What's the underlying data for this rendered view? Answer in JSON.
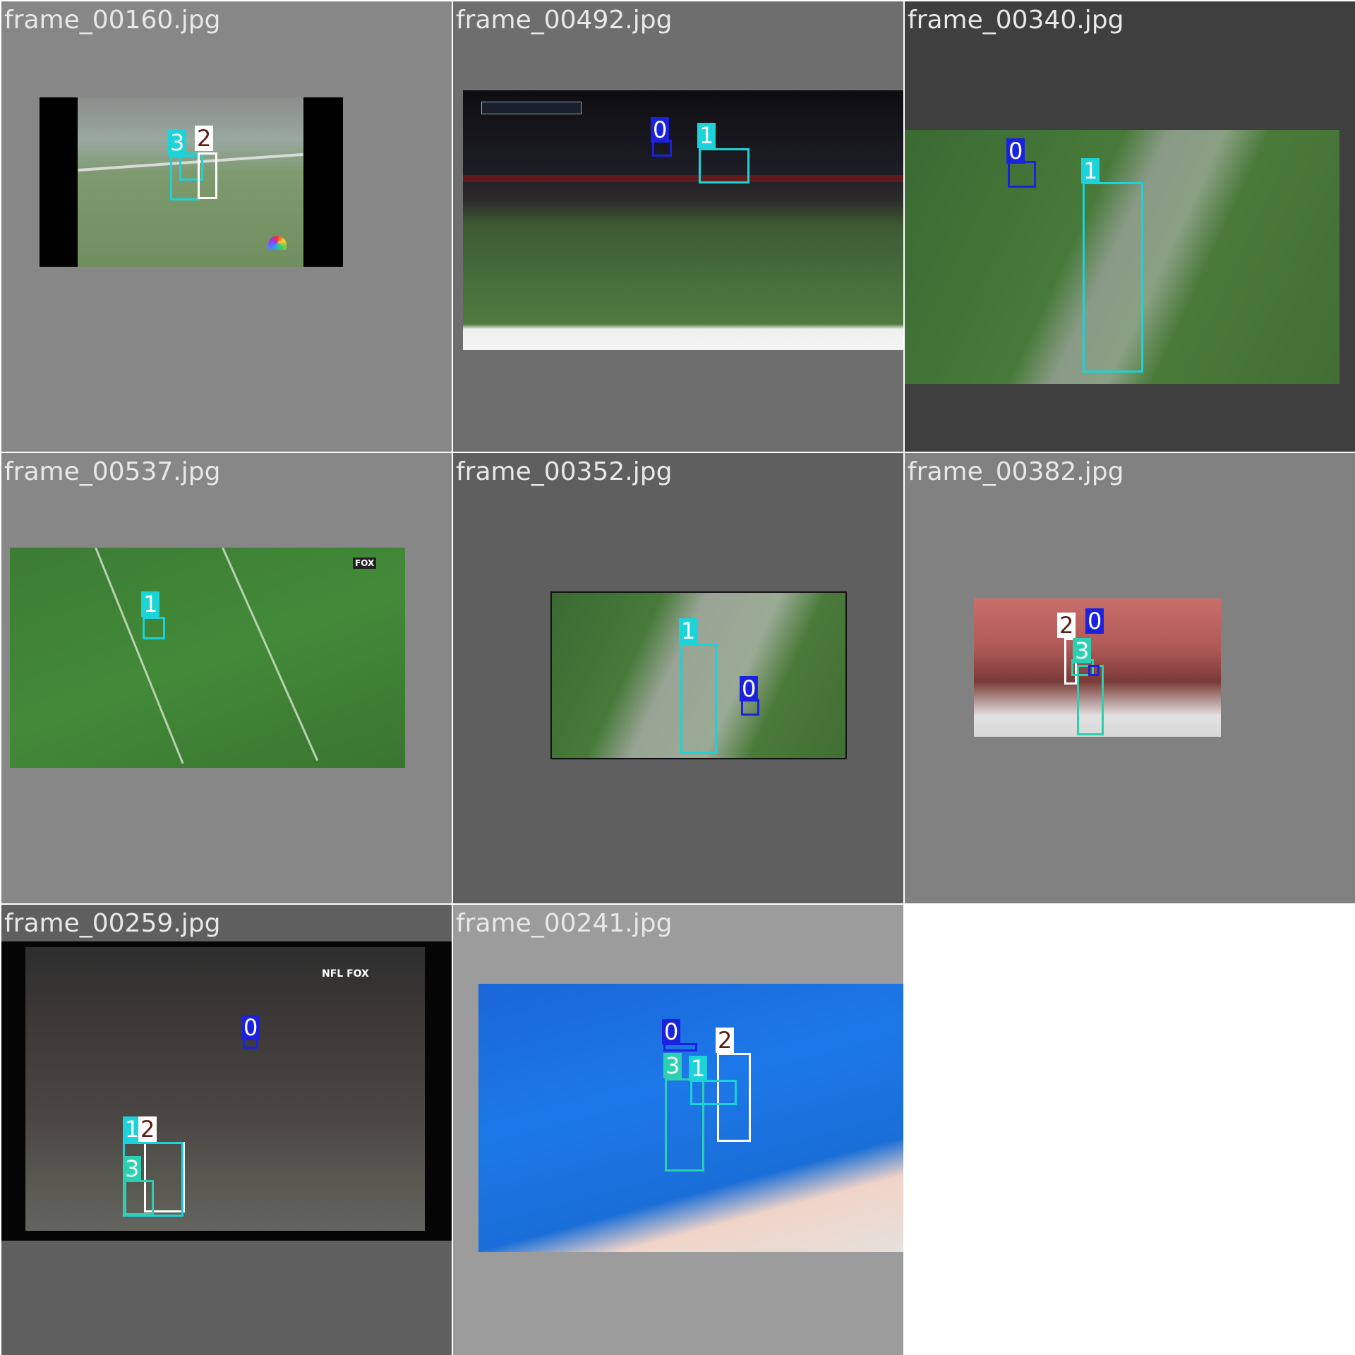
{
  "colors": {
    "class_0": "#1a22e0",
    "class_1": "#1bd3d8",
    "class_2": "#ffffff",
    "class_3": "#2ad0b0",
    "label_text_light": "#ffffff",
    "label_text_dark": "#5a1e10"
  },
  "tiles": [
    {
      "filename": "frame_00160.jpg",
      "labels": [
        "3",
        "2"
      ]
    },
    {
      "filename": "frame_00492.jpg",
      "labels": [
        "0",
        "1"
      ]
    },
    {
      "filename": "frame_00340.jpg",
      "labels": [
        "0",
        "1"
      ]
    },
    {
      "filename": "frame_00537.jpg",
      "labels": [
        "1"
      ]
    },
    {
      "filename": "frame_00352.jpg",
      "labels": [
        "1",
        "0"
      ]
    },
    {
      "filename": "frame_00382.jpg",
      "labels": [
        "2",
        "0",
        "3"
      ]
    },
    {
      "filename": "frame_00259.jpg",
      "labels": [
        "0",
        "1",
        "2",
        "3"
      ]
    },
    {
      "filename": "frame_00241.jpg",
      "labels": [
        "0",
        "2",
        "3",
        "1"
      ]
    }
  ]
}
